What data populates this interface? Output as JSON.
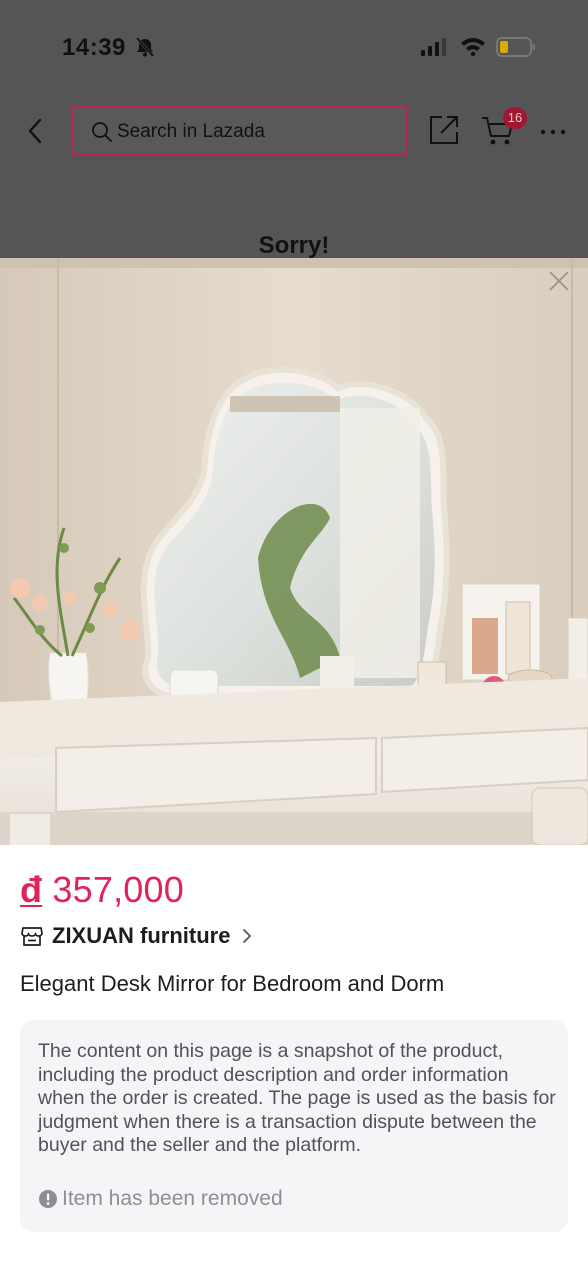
{
  "status_bar": {
    "time": "14:39"
  },
  "nav": {
    "search_placeholder": "Search in Lazada",
    "cart_count": "16"
  },
  "background_notice": {
    "title": "Sorry!"
  },
  "product": {
    "currency": "đ",
    "price": "357,000",
    "store_name": "ZIXUAN furniture",
    "title": "Elegant Desk Mirror for Bedroom and Dorm",
    "snapshot_notice": "The content on this page is a snapshot of the product, including the product description and order information when the order is created. The page is used as the basis for judgment when there is a transaction dispute between the buyer and the seller and the platform.",
    "status": "Item has been removed"
  },
  "colors": {
    "price": "#e0245a",
    "search_border": "#b42847",
    "cart_badge": "#a0172f",
    "overlay": "#555557"
  }
}
